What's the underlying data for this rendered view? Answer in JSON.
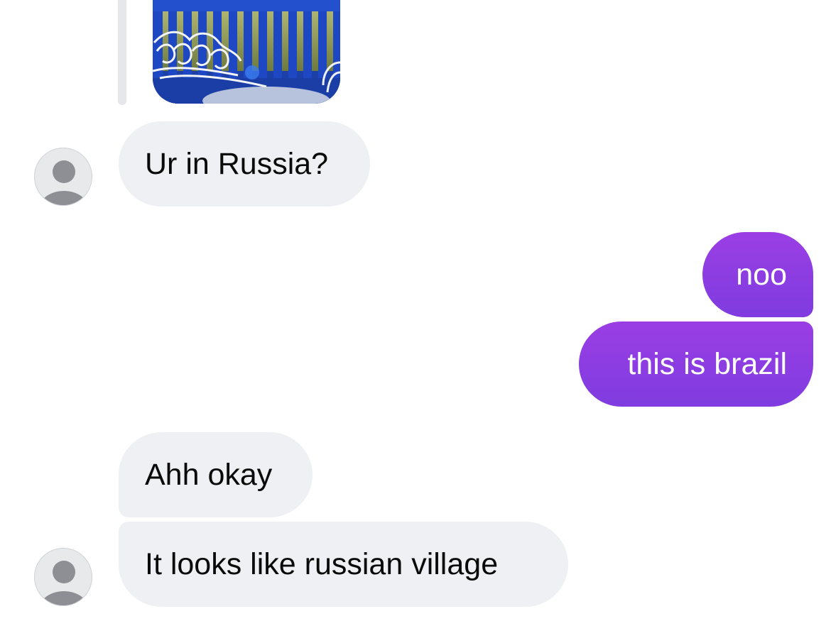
{
  "conversation": {
    "shared_photo": {
      "description_icon": "photo-thumbnail"
    },
    "messages": [
      {
        "sender": "other",
        "text": "Ur in Russia?"
      },
      {
        "sender": "me",
        "text": "noo"
      },
      {
        "sender": "me",
        "text": "this is brazil"
      },
      {
        "sender": "other",
        "text": "Ahh okay"
      },
      {
        "sender": "other",
        "text": "It looks like russian village"
      }
    ]
  },
  "colors": {
    "incoming_bubble": "#eff0f3",
    "outgoing_bubble": "#8b3de2",
    "background": "#ffffff"
  }
}
